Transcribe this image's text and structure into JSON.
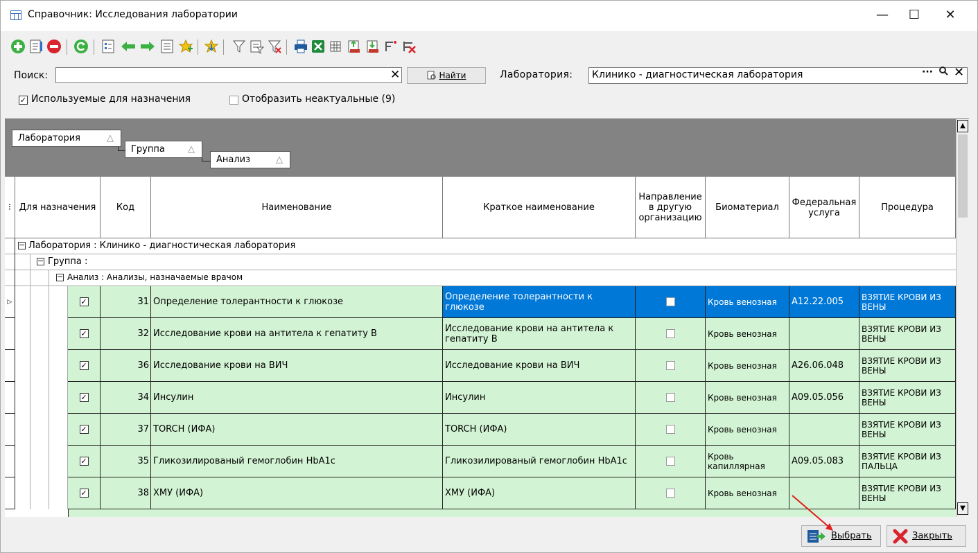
{
  "window": {
    "title": "Справочник: Исследования лаборатории",
    "minimize": "—",
    "maximize": "☐",
    "close": "✕"
  },
  "search": {
    "label": "Поиск:",
    "value": "",
    "clear": "✕",
    "find_label": "Найти"
  },
  "laboratory": {
    "label": "Лаборатория:",
    "value": "Клинико - диагностическая лаборатория",
    "ellipsis": "···",
    "find": "🔍",
    "clear": "✕"
  },
  "filters": {
    "used_for_prescription": "Используемые для назначения",
    "show_inactive": "Отобразить неактуальные (9)",
    "used_checked": true,
    "inactive_checked": false
  },
  "grouping": {
    "chips": [
      "Лаборатория",
      "Группа",
      "Анализ"
    ],
    "sort_glyph": "△"
  },
  "columns": {
    "for_prescription": "Для назначения",
    "code": "Код",
    "name": "Наименование",
    "short_name": "Краткое наименование",
    "referral": "Направление в другую организацию",
    "biomaterial": "Биоматериал",
    "federal_service": "Федеральная услуга",
    "procedure": "Процедура"
  },
  "groups": {
    "laboratory": "Лаборатория : Клинико - диагностическая лаборатория",
    "group": "Группа :",
    "analysis": "Анализ : Анализы, назначаемые врачом"
  },
  "rows": [
    {
      "code": "31",
      "name": "Определение толерантности к глюкозе",
      "short": "Определение толерантности к глюкозе",
      "bio": "Кровь венозная",
      "fed": "A12.22.005",
      "proc": "ВЗЯТИЕ КРОВИ ИЗ ВЕНЫ",
      "selected": true
    },
    {
      "code": "32",
      "name": "Исследование крови на антитела к гепатиту В",
      "short": "Исследование крови на антитела к гепатиту В",
      "bio": "Кровь венозная",
      "fed": "",
      "proc": "ВЗЯТИЕ КРОВИ ИЗ ВЕНЫ",
      "selected": false
    },
    {
      "code": "36",
      "name": "Исследование крови на ВИЧ",
      "short": "Исследование крови на ВИЧ",
      "bio": "Кровь венозная",
      "fed": "A26.06.048",
      "proc": "ВЗЯТИЕ КРОВИ ИЗ ВЕНЫ",
      "selected": false
    },
    {
      "code": "34",
      "name": "Инсулин",
      "short": "Инсулин",
      "bio": "Кровь венозная",
      "fed": "A09.05.056",
      "proc": "ВЗЯТИЕ КРОВИ ИЗ ВЕНЫ",
      "selected": false
    },
    {
      "code": "37",
      "name": "TORCH (ИФА)",
      "short": "TORCH (ИФА)",
      "bio": "Кровь венозная",
      "fed": "",
      "proc": "ВЗЯТИЕ КРОВИ ИЗ ВЕНЫ",
      "selected": false
    },
    {
      "code": "35",
      "name": "Гликозилированый гемоглобин HbA1c",
      "short": "Гликозилированый гемоглобин HbA1c",
      "bio": "Кровь капиллярная",
      "fed": "A09.05.083",
      "proc": "ВЗЯТИЕ КРОВИ ИЗ ПАЛЬЦА",
      "selected": false
    },
    {
      "code": "38",
      "name": "ХМУ (ИФА)",
      "short": "ХМУ (ИФА)",
      "bio": "Кровь венозная",
      "fed": "",
      "proc": "ВЗЯТИЕ КРОВИ ИЗ ВЕНЫ",
      "selected": false
    }
  ],
  "footer": {
    "select_label": "Выбрать",
    "close_label": "Закрыть"
  },
  "colors": {
    "row_bg": "#d3f4d4",
    "selected_bg": "#0078d7",
    "group_bar": "#838383",
    "arrow": "#e0201e"
  }
}
